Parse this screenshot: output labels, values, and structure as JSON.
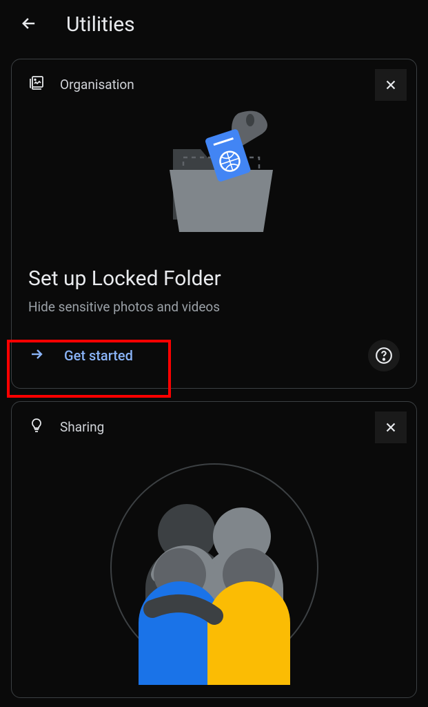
{
  "header": {
    "title": "Utilities"
  },
  "card_organisation": {
    "section": "Organisation",
    "title": "Set up Locked Folder",
    "subtitle": "Hide sensitive photos and videos",
    "cta": "Get started"
  },
  "card_sharing": {
    "section": "Sharing"
  }
}
